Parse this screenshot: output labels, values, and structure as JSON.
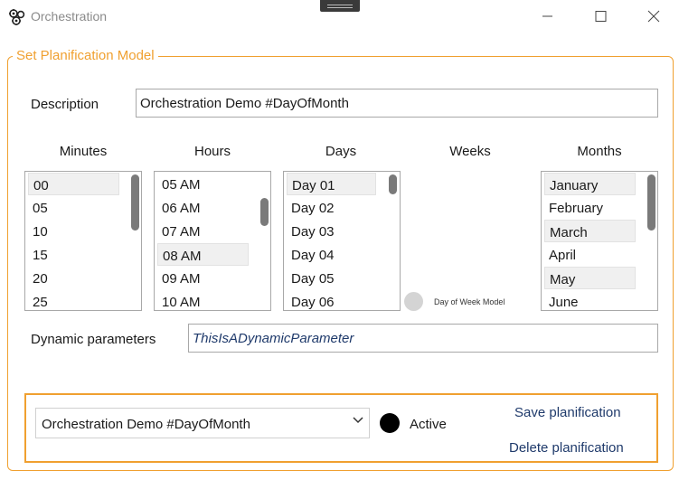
{
  "window": {
    "title": "Orchestration",
    "icon": "gear-cluster-icon"
  },
  "group": {
    "legend": "Set Planification Model",
    "accent_color": "#f0a030"
  },
  "description": {
    "label": "Description",
    "value": "Orchestration Demo #DayOfMonth"
  },
  "columns": {
    "minutes": {
      "header": "Minutes",
      "items": [
        "00",
        "05",
        "10",
        "15",
        "20",
        "25"
      ],
      "selected": [
        "00"
      ]
    },
    "hours": {
      "header": "Hours",
      "items": [
        "05 AM",
        "06 AM",
        "07 AM",
        "08 AM",
        "09 AM",
        "10 AM"
      ],
      "selected": [
        "08 AM"
      ]
    },
    "days": {
      "header": "Days",
      "items": [
        "Day 01",
        "Day 02",
        "Day 03",
        "Day 04",
        "Day 05",
        "Day 06"
      ],
      "selected": [
        "Day 01"
      ]
    },
    "weeks": {
      "header": "Weeks",
      "toggle_label": "Day of Week Model"
    },
    "months": {
      "header": "Months",
      "items": [
        "January",
        "February",
        "March",
        "April",
        "May",
        "June"
      ],
      "selected": [
        "January",
        "March",
        "May"
      ]
    }
  },
  "dynamic": {
    "label": "Dynamic parameters",
    "value": "ThisIsADynamicParameter"
  },
  "footer": {
    "selected_planification": "Orchestration Demo #DayOfMonth",
    "active_label": "Active",
    "save_label": "Save planification",
    "delete_label": "Delete planification"
  }
}
